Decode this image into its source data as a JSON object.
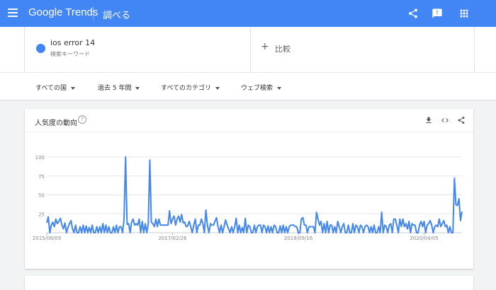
{
  "header": {
    "logo": "Google Trends",
    "explore": "調べる",
    "icons": [
      "menu-icon",
      "share-icon",
      "feedback-icon",
      "apps-icon"
    ]
  },
  "search": {
    "term": "ios error 14",
    "term_type": "検索キーワード",
    "compare_label": "比較",
    "compare_icon": "+"
  },
  "filters": [
    "すべての国",
    "過去 5 年間",
    "すべてのカテゴリ",
    "ウェブ検索"
  ],
  "card": {
    "title": "人気度の動向",
    "help_icon": "?"
  },
  "colors": {
    "header": "#4285f4",
    "series": "#4285f4"
  },
  "chart_data": {
    "type": "line",
    "ylim": [
      0,
      100
    ],
    "yticks": [
      "100",
      "75",
      "50",
      "25"
    ],
    "xticks": [
      "2015/08/09",
      "2017/02/26",
      "2018/09/16",
      "2020/04/05"
    ],
    "points": 261,
    "series": [
      {
        "values": [
          13,
          21,
          0,
          10,
          14,
          8,
          18,
          12,
          15,
          19,
          10,
          5,
          13,
          0,
          7,
          12,
          16,
          5,
          0,
          10,
          0,
          0,
          8,
          0,
          10,
          0,
          9,
          0,
          7,
          0,
          10,
          0,
          0,
          8,
          0,
          8,
          0,
          12,
          0,
          10,
          0,
          8,
          0,
          0,
          8,
          0,
          10,
          0,
          8,
          8,
          0,
          18,
          100,
          11,
          12,
          0,
          14,
          18,
          10,
          12,
          10,
          18,
          0,
          15,
          0,
          12,
          0,
          12,
          96,
          14,
          12,
          8,
          18,
          8,
          18,
          10,
          10,
          10,
          10,
          10,
          10,
          29,
          12,
          18,
          22,
          10,
          18,
          22,
          14,
          24,
          13,
          14,
          8,
          9,
          15,
          8,
          0,
          10,
          18,
          0,
          10,
          10,
          18,
          12,
          0,
          30,
          10,
          0,
          12,
          10,
          10,
          15,
          20,
          8,
          0,
          10,
          0,
          8,
          17,
          10,
          5,
          0,
          8,
          0,
          8,
          19,
          0,
          10,
          0,
          7,
          0,
          19,
          0,
          10,
          8,
          0,
          0,
          10,
          0,
          8,
          10,
          10,
          0,
          10,
          8,
          0,
          9,
          0,
          8,
          0,
          10,
          8,
          0,
          0,
          9,
          0,
          10,
          0,
          8,
          0,
          8,
          10,
          10,
          10,
          8,
          8,
          0,
          0,
          18,
          20,
          10,
          10,
          0,
          8,
          8,
          8,
          8,
          0,
          27,
          18,
          10,
          15,
          0,
          12,
          0,
          15,
          0,
          10,
          10,
          0,
          8,
          0,
          15,
          8,
          0,
          8,
          12,
          0,
          0,
          10,
          0,
          0,
          12,
          0,
          10,
          8,
          0,
          10,
          8,
          0,
          8,
          10,
          8,
          0,
          8,
          0,
          10,
          0,
          0,
          8,
          0,
          27,
          0,
          10,
          8,
          0,
          10,
          12,
          0,
          18,
          18,
          10,
          0,
          18,
          8,
          18,
          8,
          12,
          5,
          15,
          0,
          12,
          10,
          10,
          0,
          0,
          10,
          15,
          8,
          15,
          0,
          10,
          12,
          16,
          10,
          0,
          8,
          10,
          8,
          18,
          8,
          12,
          16,
          8,
          10,
          0,
          8,
          0,
          0,
          72,
          37,
          36,
          45,
          16,
          28
        ]
      }
    ]
  }
}
